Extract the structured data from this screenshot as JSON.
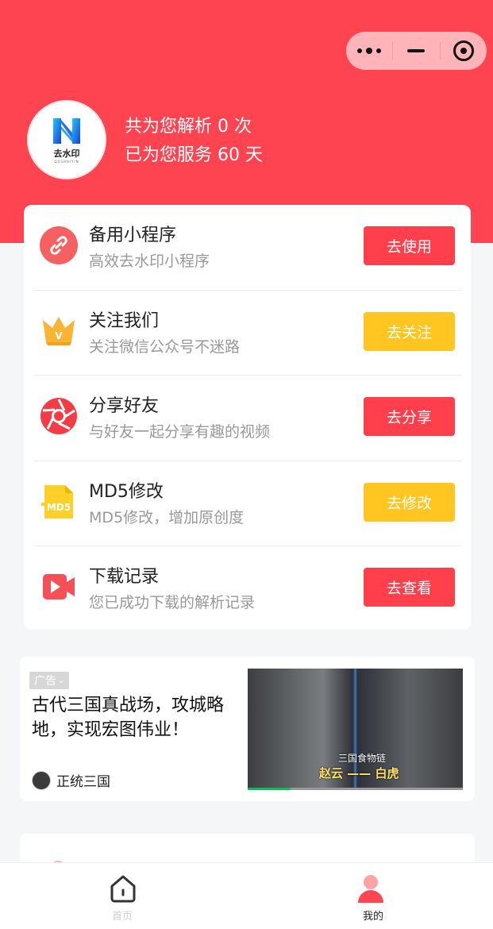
{
  "header": {
    "stats_line1": "共为您解析 0 次",
    "stats_line2": "已为您服务 60 天",
    "logo_text": "去水印",
    "logo_sub": "QUSHUIYIN",
    "accent_color": "#ff4451"
  },
  "capsule": {
    "more_icon": "more-dots-icon",
    "minimize_icon": "minus-icon",
    "close_icon": "target-icon"
  },
  "menu": {
    "items": [
      {
        "title": "备用小程序",
        "desc": "高效去水印小程序",
        "button": "去使用",
        "icon": "link-icon",
        "button_color": "#ff3f4c"
      },
      {
        "title": "关注我们",
        "desc": "关注微信公众号不迷路",
        "button": "去关注",
        "icon": "crown-icon",
        "button_color": "#ffc622"
      },
      {
        "title": "分享好友",
        "desc": "与好友一起分享有趣的视频",
        "button": "去分享",
        "icon": "aperture-icon",
        "button_color": "#ff3f4c"
      },
      {
        "title": "MD5修改",
        "desc": "MD5修改，增加原创度",
        "button": "去修改",
        "icon": "md5-file-icon",
        "button_color": "#ffc622"
      },
      {
        "title": "下载记录",
        "desc": "您已成功下载的解析记录",
        "button": "去查看",
        "icon": "video-camera-icon",
        "button_color": "#ff3f4c"
      }
    ],
    "md5_icon_text": "MD5"
  },
  "ad": {
    "tag": "广告",
    "title": "古代三国真战场，攻城略地，实现宏图伟业！",
    "brand": "正统三国",
    "image_caption_top": "三国食物链",
    "image_caption_bottom": "赵云 —— 白虎",
    "progress": 0.2
  },
  "tabbar": {
    "home_label": "首页",
    "mine_label": "我的"
  }
}
